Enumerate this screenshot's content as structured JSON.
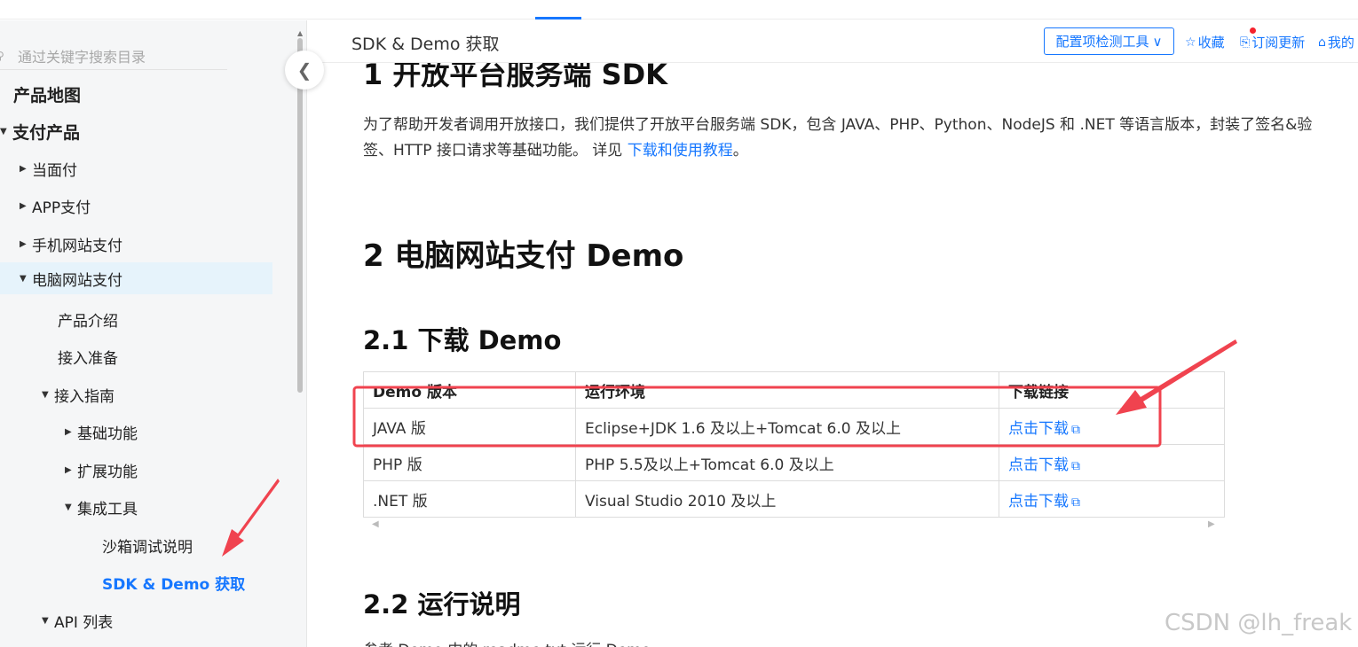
{
  "sidebar": {
    "search_placeholder": "通过关键字搜索目录",
    "items": [
      {
        "label": "产品地图"
      },
      {
        "label": "支付产品"
      },
      {
        "label": "当面付"
      },
      {
        "label": "APP支付"
      },
      {
        "label": "手机网站支付"
      },
      {
        "label": "电脑网站支付"
      },
      {
        "label": "产品介绍"
      },
      {
        "label": "接入准备"
      },
      {
        "label": "接入指南"
      },
      {
        "label": "基础功能"
      },
      {
        "label": "扩展功能"
      },
      {
        "label": "集成工具"
      },
      {
        "label": "沙箱调试说明"
      },
      {
        "label": "SDK & Demo 获取"
      },
      {
        "label": "API 列表"
      }
    ]
  },
  "header": {
    "title": "SDK & Demo 获取",
    "config_button": "配置项检测工具",
    "favorite": "收藏",
    "subscribe": "订阅更新",
    "mine": "我的"
  },
  "content": {
    "h1": "1 开放平台服务端 SDK",
    "para1_a": "为了帮助开发者调用开放接口，我们提供了开放平台服务端 SDK，包含 JAVA、PHP、Python、NodeJS 和 .NET 等语言版本，封装了签名&验",
    "para1_b": "签、HTTP 接口请求等基础功能。 详见 ",
    "para1_link": "下载和使用教程",
    "para1_end": "。",
    "h2": "2 电脑网站支付 Demo",
    "h3_download": "2.1 下载 Demo",
    "h3_run": "2.2 运行说明",
    "para2": "参考 Demo 中的 readme.txt 运行 Demo。",
    "table": {
      "headers": [
        "Demo 版本",
        "运行环境",
        "下载链接"
      ],
      "rows": [
        {
          "version": "JAVA 版",
          "env": "Eclipse+JDK 1.6 及以上+Tomcat 6.0 及以上",
          "link": "点击下载"
        },
        {
          "version": "PHP 版",
          "env": "PHP 5.5及以上+Tomcat 6.0 及以上",
          "link": "点击下载"
        },
        {
          "version": ".NET 版",
          "env": "Visual Studio 2010 及以上",
          "link": "点击下载"
        }
      ]
    }
  },
  "watermark": "CSDN @lh_freak",
  "colors": {
    "accent": "#1677ff",
    "annotation": "#f0434f",
    "selected_bg": "#e6f3fb"
  }
}
